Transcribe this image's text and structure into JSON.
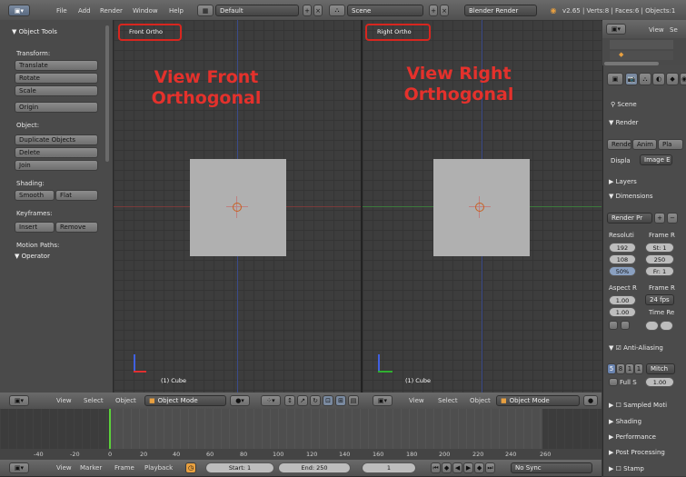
{
  "top": {
    "menus": [
      "File",
      "Add",
      "Render",
      "Window",
      "Help"
    ],
    "layout": "Default",
    "scene": "Scene",
    "engine": "Blender Render",
    "stats": "v2.65 | Verts:8 | Faces:6 | Objects:1"
  },
  "toolshelf": {
    "title": "Object Tools",
    "transform_label": "Transform:",
    "translate": "Translate",
    "rotate": "Rotate",
    "scale": "Scale",
    "origin": "Origin",
    "object_label": "Object:",
    "duplicate": "Duplicate Objects",
    "delete": "Delete",
    "join": "Join",
    "shading_label": "Shading:",
    "smooth": "Smooth",
    "flat": "Flat",
    "keyframes_label": "Keyframes:",
    "insert": "Insert",
    "remove": "Remove",
    "motion_label": "Motion Paths:",
    "operator": "Operator"
  },
  "viewports": {
    "left": {
      "label": "Front Ortho",
      "annotation1": "View Front",
      "annotation2": "Orthogonal",
      "object": "(1) Cube"
    },
    "right": {
      "label": "Right Ortho",
      "annotation1": "View Right",
      "annotation2": "Orthogonal",
      "object": "(1) Cube"
    }
  },
  "view3d_header": {
    "view": "View",
    "select": "Select",
    "object": "Object",
    "mode": "Object Mode"
  },
  "timeline": {
    "ticks": [
      "-40",
      "-20",
      "0",
      "20",
      "40",
      "60",
      "80",
      "100",
      "120",
      "140",
      "160",
      "180",
      "200",
      "220",
      "240",
      "260"
    ],
    "view": "View",
    "marker": "Marker",
    "frame": "Frame",
    "playback": "Playback",
    "start": "Start: 1",
    "end": "End: 250",
    "current": "1",
    "sync": "No Sync"
  },
  "outliner": {
    "view": "View",
    "search": "Se"
  },
  "properties": {
    "scene": "Scene",
    "render": "Render",
    "render_btn": "Render",
    "anim_btn": "Anim",
    "play_btn": "Pla",
    "display_label": "Displa",
    "display_value": "Image E",
    "layers": "Layers",
    "dimensions": "Dimensions",
    "preset": "Render Pr",
    "resolution": "Resoluti",
    "frame_range": "Frame R",
    "res_x": "192",
    "res_y": "108",
    "res_pct": "50%",
    "start": "St: 1",
    "end": "250",
    "step": "Fr: 1",
    "aspect": "Aspect R",
    "frame_rate": "Frame R",
    "aspect_x": "1.00",
    "aspect_y": "1.00",
    "fps": "24 fps",
    "time_re": "Time Re",
    "anti_aliasing": "Anti-Aliasing",
    "aa_values": [
      "5",
      "8",
      "1",
      "1"
    ],
    "mitch": "Mitch",
    "full_s": "Full S",
    "full_s_value": "1.00",
    "sampled": "Sampled Moti",
    "shading": "Shading",
    "performance": "Performance",
    "post": "Post Processing",
    "stamp": "Stamp"
  },
  "colors": {
    "annotation": "#e4312c",
    "accent": "#5577aa"
  }
}
